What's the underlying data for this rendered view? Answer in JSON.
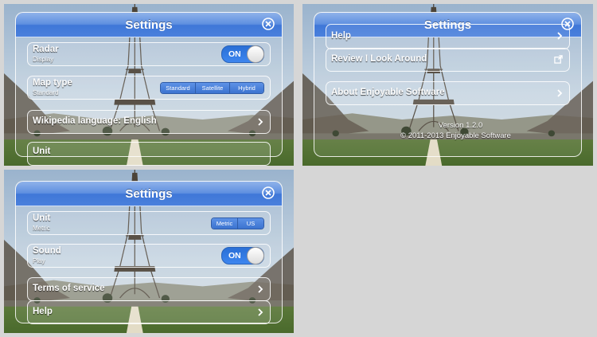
{
  "panel1": {
    "title": "Settings",
    "radar": {
      "label": "Radar",
      "sublabel": "Display",
      "toggle": "ON"
    },
    "map_type": {
      "label": "Map type",
      "sublabel": "Standard",
      "options": [
        "Standard",
        "Satellite",
        "Hybrid"
      ]
    },
    "wikipedia": {
      "label": "Wikipedia language: English"
    },
    "unit_partial": {
      "label": "Unit"
    }
  },
  "panel2": {
    "title": "Settings",
    "help_partial": {
      "label": "Help"
    },
    "review": {
      "label": "Review I Look Around"
    },
    "about": {
      "label": "About Enjoyable Software"
    },
    "version": "Version 1.2.0",
    "copyright": "© 2011-2013 Enjoyable Software"
  },
  "panel3": {
    "title": "Settings",
    "unit": {
      "label": "Unit",
      "sublabel": "Metric",
      "options": [
        "Metric",
        "US"
      ]
    },
    "sound": {
      "label": "Sound",
      "sublabel": "Play",
      "toggle": "ON"
    },
    "terms": {
      "label": "Terms of service"
    },
    "help": {
      "label": "Help"
    }
  },
  "icons": {
    "close": "close-circle-icon",
    "chevron": "chevron-right-icon",
    "external": "external-link-icon"
  },
  "colors": {
    "accent": "#3f77d8",
    "toggle_on": "#2a6fd6"
  }
}
